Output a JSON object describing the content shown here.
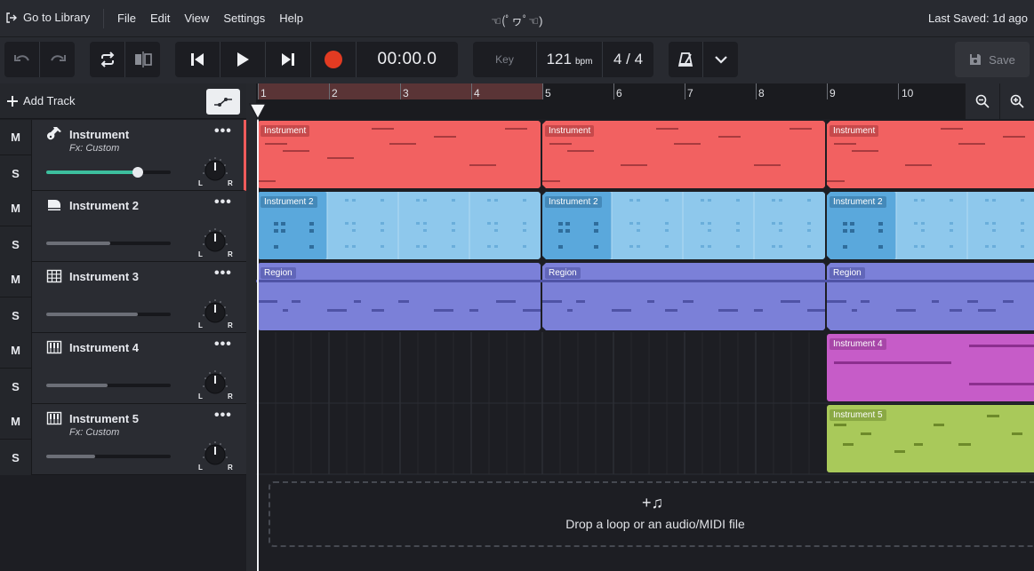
{
  "menubar": {
    "library_label": "Go to Library",
    "menus": [
      "File",
      "Edit",
      "View",
      "Settings",
      "Help"
    ],
    "title": "☜(ﾟヮﾟ☜)",
    "last_saved": "Last Saved: 1d ago"
  },
  "toolbar": {
    "time": "00:00.0",
    "key_label": "Key",
    "bpm_value": "121",
    "bpm_unit": "bpm",
    "time_signature": "4 / 4",
    "save_label": "Save"
  },
  "tracks_panel": {
    "add_track_label": "Add Track",
    "mute_label": "M",
    "solo_label": "S",
    "tracks": [
      {
        "name": "Instrument",
        "fx": "Fx: Custom",
        "icon": "guitar-icon",
        "volume": 0.74,
        "color": "#f26161"
      },
      {
        "name": "Instrument 2",
        "fx": "",
        "icon": "piano-icon",
        "volume": 0.52,
        "color": "#8ec8ec"
      },
      {
        "name": "Instrument 3",
        "fx": "",
        "icon": "grid-pad-icon",
        "volume": 0.74,
        "color": "#7b80d8"
      },
      {
        "name": "Instrument 4",
        "fx": "",
        "icon": "keyboard-icon",
        "volume": 0.5,
        "color": "#c65cc8"
      },
      {
        "name": "Instrument 5",
        "fx": "Fx: Custom",
        "icon": "keyboard-icon",
        "volume": 0.39,
        "color": "#a9c95a"
      }
    ]
  },
  "timeline": {
    "bars": [
      "1",
      "2",
      "3",
      "4",
      "5",
      "6",
      "7",
      "8",
      "9",
      "10"
    ],
    "loop_bars": [
      1,
      5
    ],
    "region_labels": {
      "track1": "Instrument",
      "track2": "Instrument 2",
      "track3": "Region",
      "track4": "Instrument 4",
      "track5": "Instrument 5"
    },
    "drop_text": "Drop a loop or an audio/MIDI file"
  }
}
